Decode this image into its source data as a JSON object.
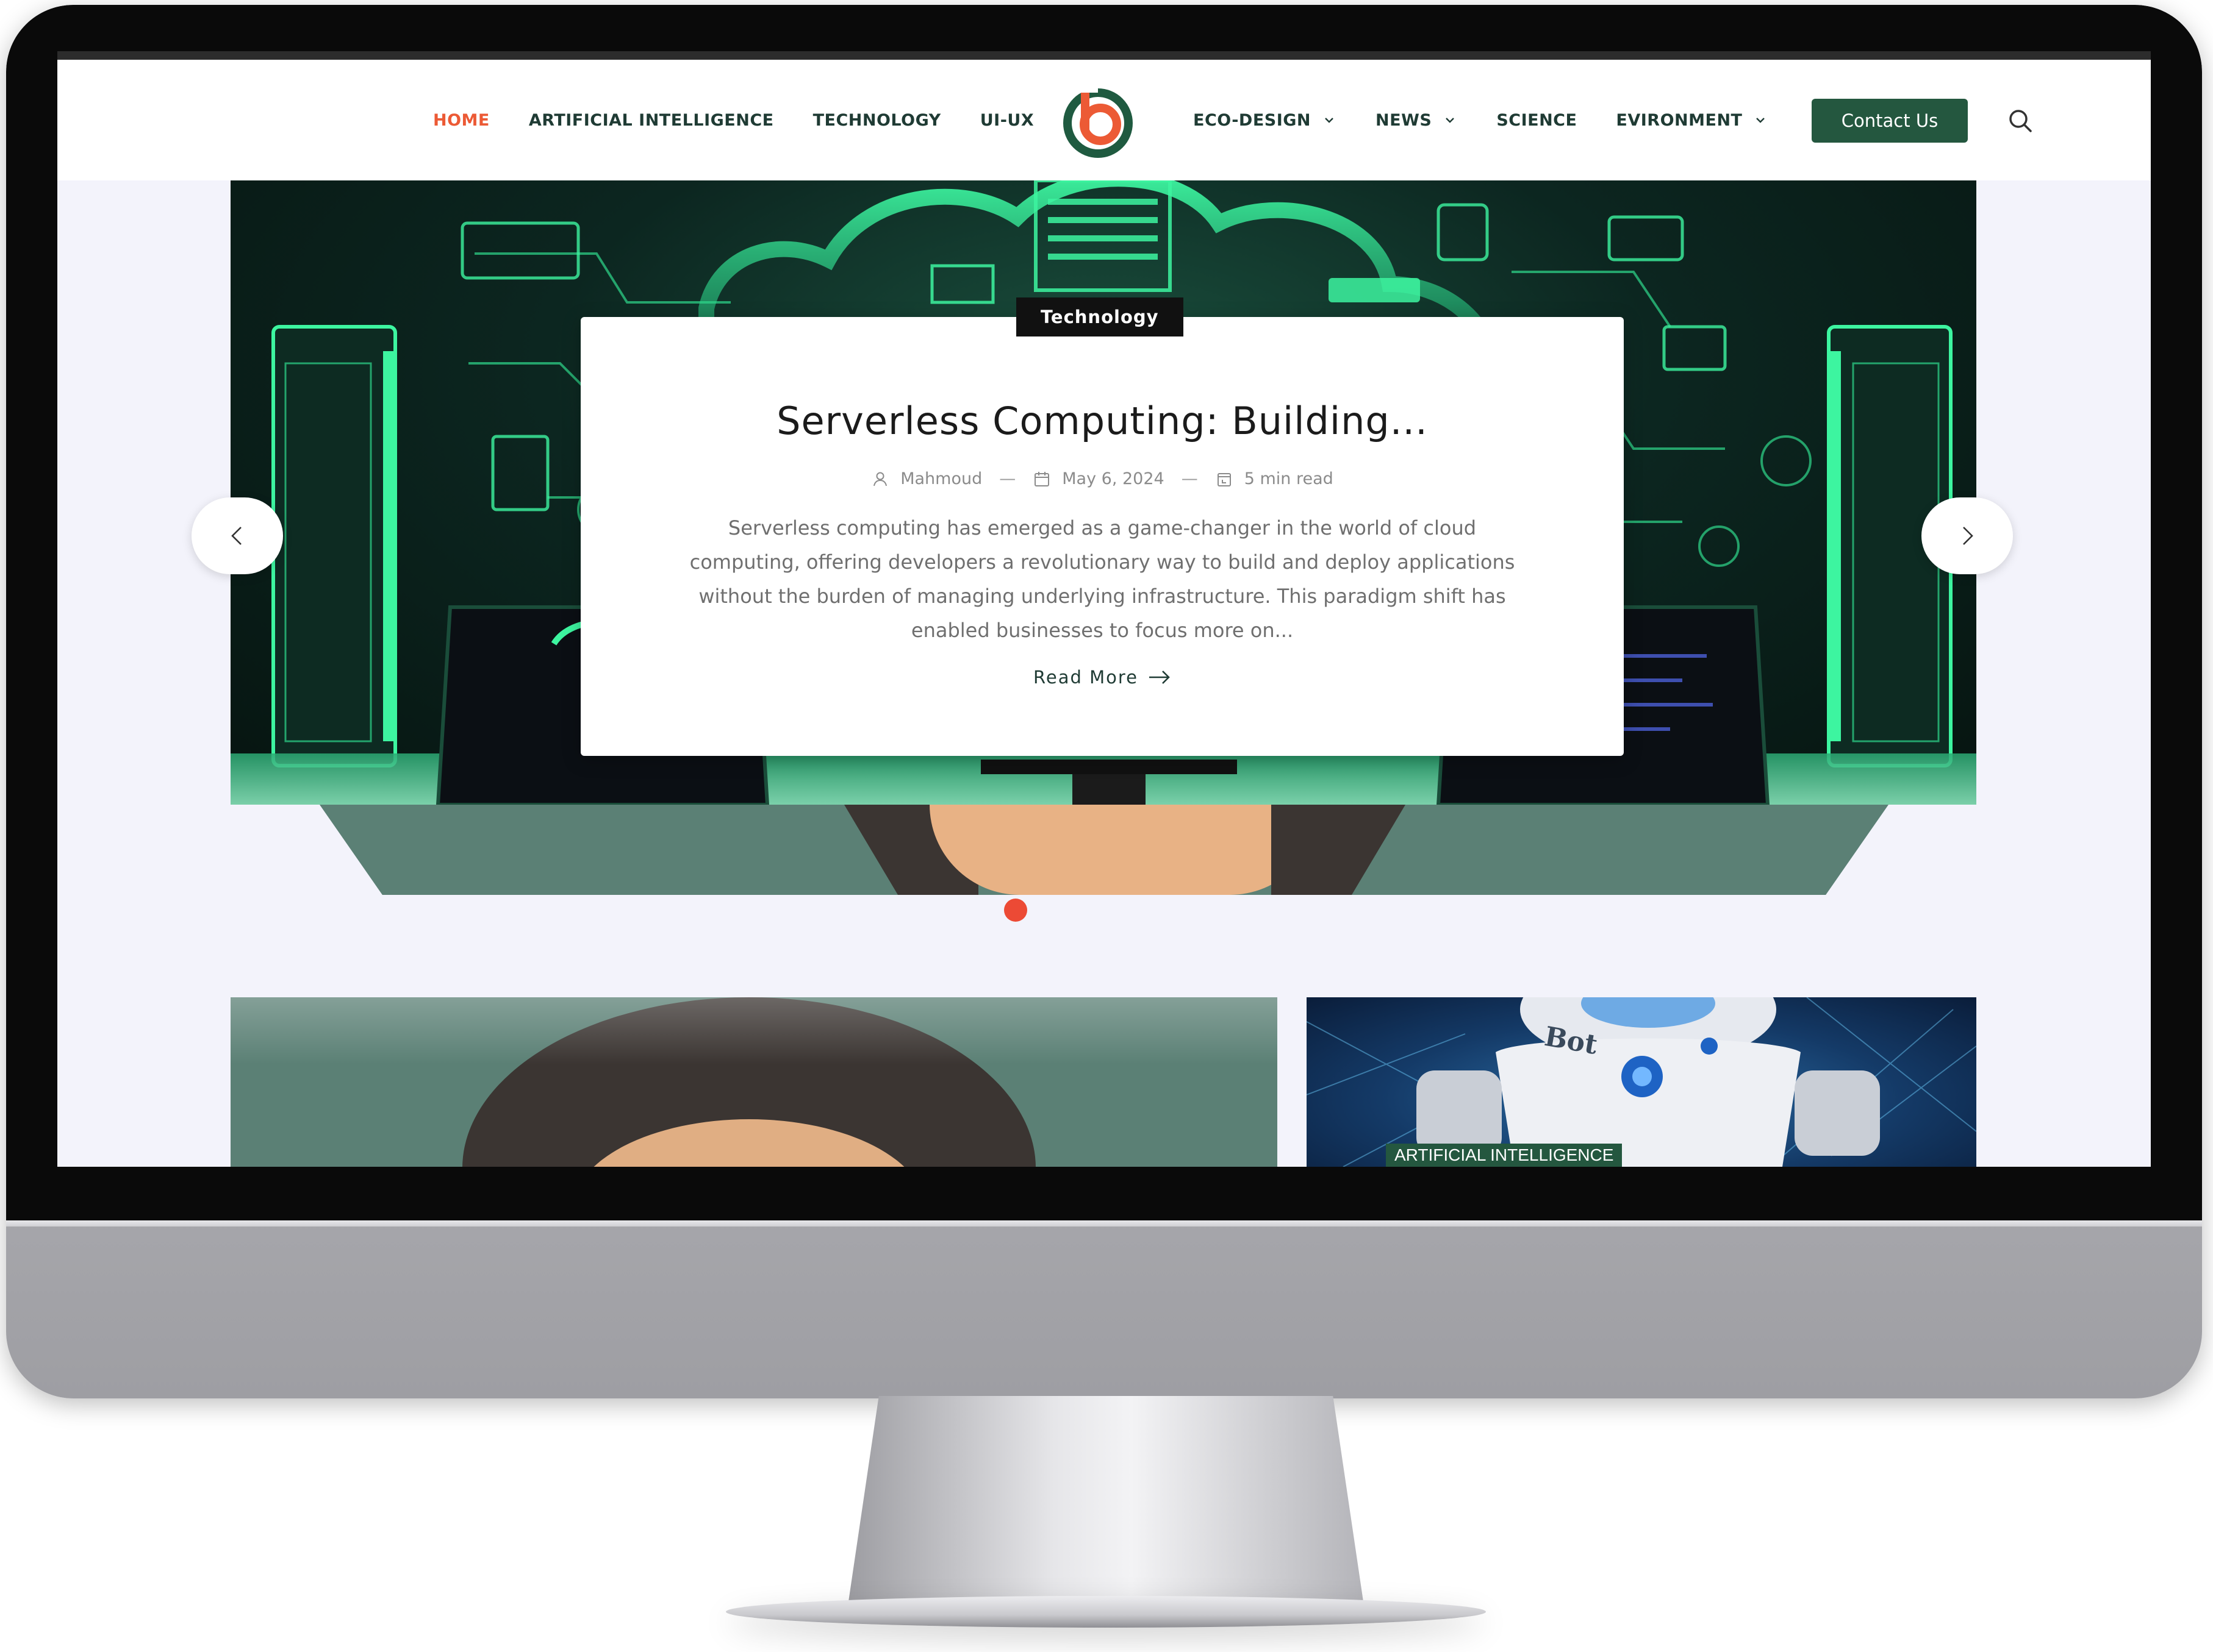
{
  "nav": {
    "left": [
      {
        "label": "HOME",
        "active": true
      },
      {
        "label": "ARTIFICIAL INTELLIGENCE",
        "active": false
      },
      {
        "label": "TECHNOLOGY",
        "active": false
      },
      {
        "label": "UI-UX",
        "active": false
      }
    ],
    "right": [
      {
        "label": "ECO-DESIGN",
        "dropdown": true
      },
      {
        "label": "NEWS",
        "dropdown": true
      },
      {
        "label": "SCIENCE",
        "dropdown": false
      },
      {
        "label": "EVIRONMENT",
        "dropdown": true
      }
    ],
    "contact_label": "Contact Us",
    "logo_icon": "brand-logo-b",
    "search_icon": "search-icon"
  },
  "hero": {
    "category": "Technology",
    "title": "Serverless Computing: Building...",
    "author": "Mahmoud",
    "date": "May 6, 2024",
    "read_time": "5 min read",
    "excerpt": "Serverless computing has emerged as a game-changer in the world of cloud computing, offering developers a revolutionary way to build and deploy applications without the burden of managing underlying infrastructure. This paradigm shift has enabled businesses to focus more on...",
    "read_more": "Read More",
    "meta_separator": "—"
  },
  "lower": {
    "right_card_category": "ARTIFICIAL INTELLIGENCE",
    "robot_text": "Bot"
  },
  "colors": {
    "accent": "#ec5a35",
    "brand_green": "#24573f",
    "nav_text": "#1f3b34",
    "screen_bg": "#f3f3fb",
    "neon": "#3df5a0"
  }
}
